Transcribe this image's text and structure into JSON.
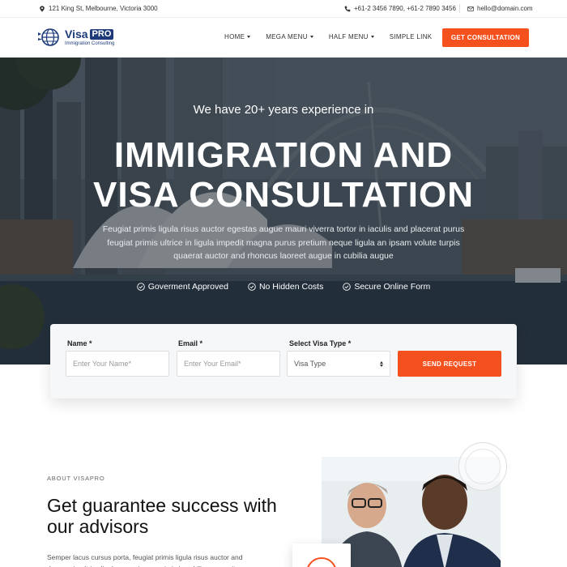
{
  "topbar": {
    "address": "121 King St, Melbourne, Victoria 3000",
    "phones": "+61-2 3456 7890,   +61-2 7890 3456",
    "email": "hello@domain.com"
  },
  "header": {
    "logo_title": "Visa",
    "logo_pro": "PRO",
    "logo_subtitle": "Immigration Consulting",
    "nav": [
      {
        "label": "HOME",
        "dropdown": true
      },
      {
        "label": "MEGA MENU",
        "dropdown": true
      },
      {
        "label": "HALF MENU",
        "dropdown": true
      },
      {
        "label": "SIMPLE LINK",
        "dropdown": false
      }
    ],
    "cta_label": "GET CONSULTATION"
  },
  "hero": {
    "subtitle": "We have 20+ years experience in",
    "title_line1": "IMMIGRATION AND",
    "title_line2": "VISA CONSULTATION",
    "description": "Feugiat primis ligula risus auctor egestas augue mauri viverra tortor in iaculis and placerat purus feugiat primis ultrice in ligula impedit magna purus pretium neque ligula an ipsam volute turpis quaerat auctor and rhoncus laoreet augue in cubilia augue",
    "badges": [
      "Goverment Approved",
      "No Hidden Costs",
      "Secure Online Form"
    ]
  },
  "form": {
    "name_label": "Name *",
    "name_placeholder": "Enter Your Name*",
    "email_label": "Email *",
    "email_placeholder": "Enter Your Email*",
    "visa_label": "Select Visa Type *",
    "visa_selected": "Visa Type",
    "submit_label": "SEND REQUEST"
  },
  "about": {
    "eyebrow": "ABOUT VISAPRO",
    "title": "Get guarantee success with our advisors",
    "text": "Semper lacus cursus porta, feugiat primis ligula risus auctor and rhoncus in ultrice ligula purus ipsum primis in cubilia augue vitae"
  },
  "colors": {
    "accent": "#f4511e",
    "brand": "#1d3b7a"
  }
}
